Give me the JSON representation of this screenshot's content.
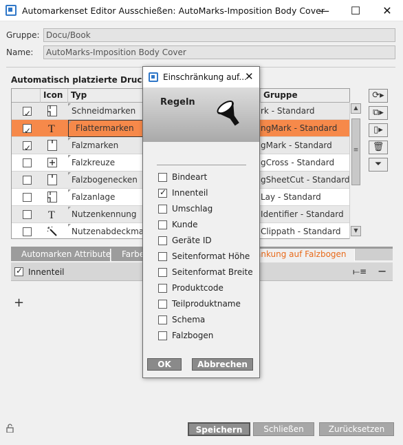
{
  "window": {
    "title": "Automarkenset Editor Ausschießen: AutoMarks-Imposition Body Cover",
    "minimize": "—",
    "maximize": "☐",
    "close": "✕"
  },
  "form": {
    "group_label": "Gruppe:",
    "group_value": "Docu/Book",
    "name_label": "Name:",
    "name_value": "AutoMarks-Imposition Body Cover",
    "section_title": "Automatisch platzierte Druckkont"
  },
  "table": {
    "columns": [
      "Icon",
      "Typ",
      "Gruppe"
    ],
    "rows": [
      {
        "checked": true,
        "icon": "doc-corner-icon",
        "type": "Schneidmarken",
        "group": "rk - Standard"
      },
      {
        "checked": true,
        "icon": "text-T-icon",
        "type": "Flattermarken",
        "group": "ngMark - Standard"
      },
      {
        "checked": true,
        "icon": "doc-fold-icon",
        "type": "Falzmarken",
        "group": "gMark - Standard"
      },
      {
        "checked": false,
        "icon": "crosshair-icon",
        "type": "Falzkreuze",
        "group": "gCross - Standard"
      },
      {
        "checked": false,
        "icon": "doc-fold-icon",
        "type": "Falzbogenecken",
        "group": "gSheetCut - Standard"
      },
      {
        "checked": false,
        "icon": "doc-corner-icon",
        "type": "Falzanlage",
        "group": "Lay - Standard"
      },
      {
        "checked": false,
        "icon": "text-T-icon",
        "type": "Nutzenkennung",
        "group": "Identifier - Standard"
      },
      {
        "checked": false,
        "icon": "magic-wand-icon",
        "type": "Nutzenabdeckmark",
        "group": "Clippath - Standard"
      }
    ],
    "selected_index": 1
  },
  "tabs": [
    {
      "label": "Automarken Attribute"
    },
    {
      "label": "Farbe"
    },
    {
      "label": "änkung auf Falzbogen"
    }
  ],
  "filter": {
    "checked": true,
    "label": "Innenteil",
    "remove": "−"
  },
  "add_label": "+",
  "buttons": {
    "save": "Speichern",
    "close": "Schließen",
    "reset": "Zurücksetzen"
  },
  "dialog": {
    "title": "Einschränkung auf...",
    "close": "✕",
    "heading": "Regeln",
    "options": [
      {
        "label": "Bindeart",
        "checked": false
      },
      {
        "label": "Innenteil",
        "checked": true
      },
      {
        "label": "Umschlag",
        "checked": false
      },
      {
        "label": "Kunde",
        "checked": false
      },
      {
        "label": "Geräte ID",
        "checked": false
      },
      {
        "label": "Seitenformat Höhe",
        "checked": false
      },
      {
        "label": "Seitenformat Breite",
        "checked": false
      },
      {
        "label": "Produktcode",
        "checked": false
      },
      {
        "label": "Teilproduktname",
        "checked": false
      },
      {
        "label": "Schema",
        "checked": false
      },
      {
        "label": "Falzbogen",
        "checked": false
      }
    ],
    "ok": "OK",
    "cancel": "Abbrechen"
  },
  "colors": {
    "selected_row": "#f6894a",
    "active_tab_text": "#e86a1a",
    "accent_blue": "#2f77c8"
  }
}
